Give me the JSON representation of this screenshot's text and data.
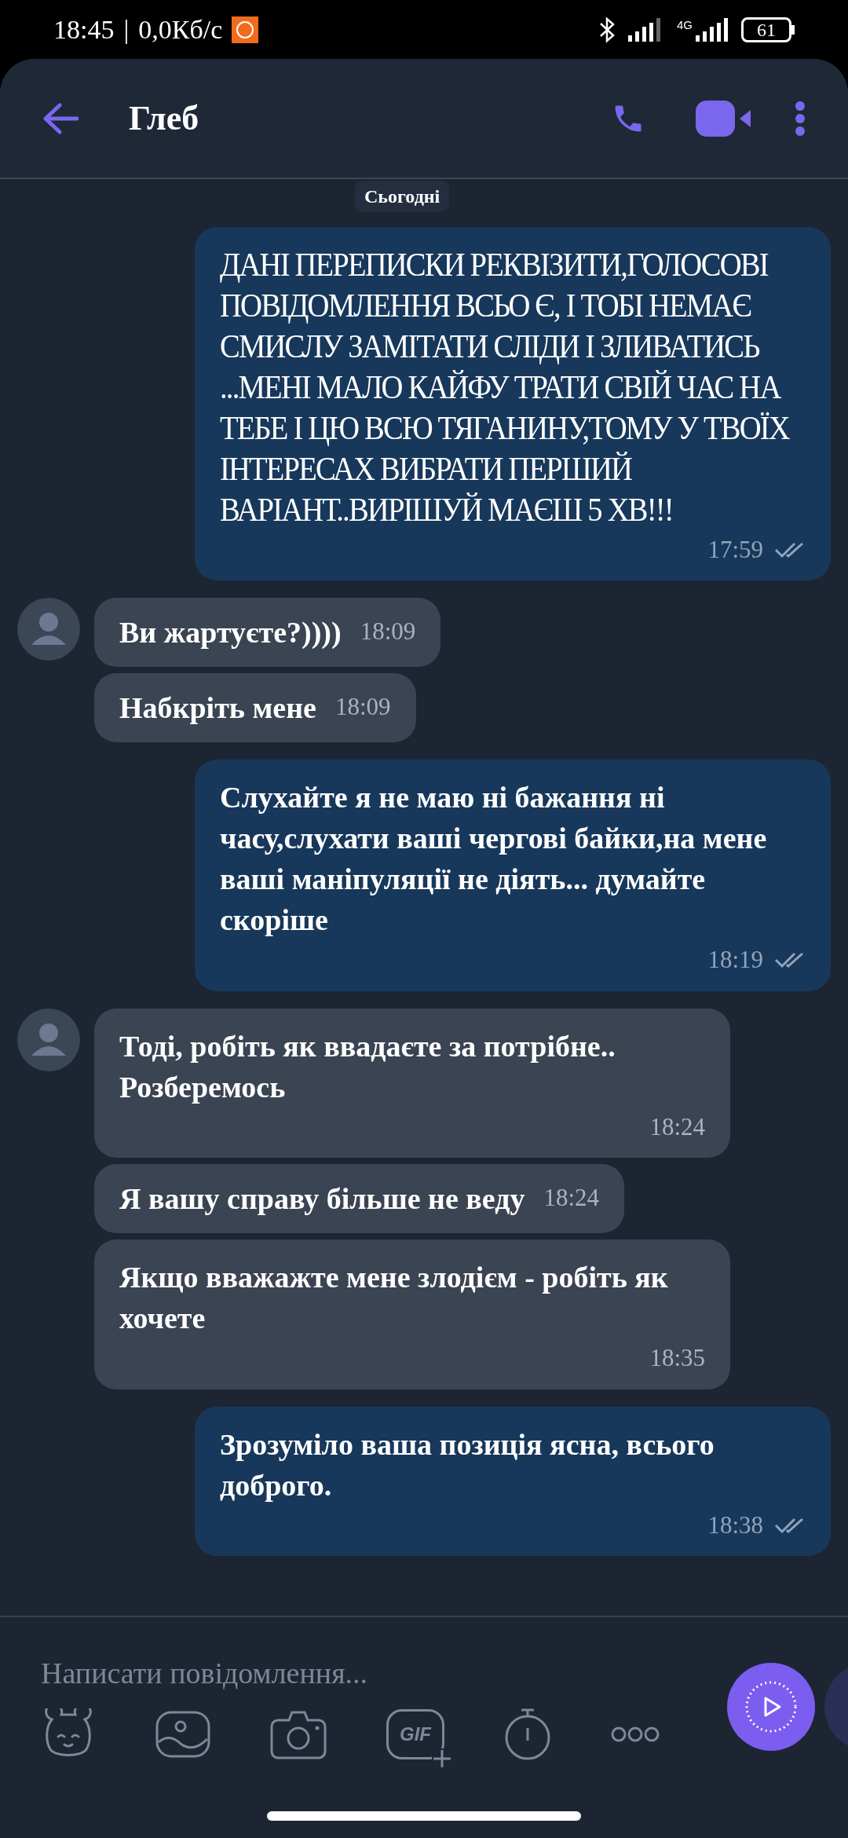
{
  "status_bar": {
    "time": "18:45",
    "separator": "|",
    "speed": "0,0Кб/с",
    "network": "4G",
    "battery": "61"
  },
  "header": {
    "contact": "Глеб"
  },
  "date_badge": "Сьогодні",
  "messages": [
    {
      "kind": "outgoing",
      "text": "ДАНІ ПЕРЕПИСКИ РЕКВІЗИТИ,ГОЛОСОВІ ПОВІДОМЛЕННЯ ВСЬО Є, І ТОБІ НЕМАЄ СМИСЛУ ЗАМІТАТИ СЛІДИ І ЗЛИВАТИСЬ ...МЕНІ МАЛО КАЙФУ ТРАТИ СВІЙ ЧАС НА ТЕБЕ І ЦЮ ВСЮ ТЯГАНИНУ,ТОМУ У ТВОЇХ ІНТЕРЕСАХ ВИБРАТИ ПЕРШИЙ ВАРІАНТ..ВИРІШУЙ МАЄШ 5 ХВ!!!",
      "time": "17:59",
      "read": true
    },
    {
      "kind": "incoming",
      "avatar": true,
      "text": "Ви жартуєте?))))",
      "time": "18:09"
    },
    {
      "kind": "incoming",
      "avatar": false,
      "text": "Набкріть мене",
      "time": "18:09"
    },
    {
      "kind": "outgoing",
      "text": "Слухайте я не маю ні бажання ні часу,слухати ваші чергові байки,на мене ваші маніпуляції не діять... думайте скоріше",
      "time": "18:19",
      "read": true
    },
    {
      "kind": "incoming",
      "avatar": true,
      "text": "Тоді, робіть як ввадаєте за потрібне.. Розберемось",
      "time": "18:24"
    },
    {
      "kind": "incoming",
      "avatar": false,
      "text": "Я вашу справу більше не веду",
      "time": "18:24"
    },
    {
      "kind": "incoming",
      "avatar": false,
      "text": "Якщо вважажте мене злодієм - робіть як хочете",
      "time": "18:35"
    },
    {
      "kind": "outgoing",
      "text": "Зрозуміло ваша позиція ясна, всього доброго.",
      "time": "18:38",
      "read": true
    }
  ],
  "composer": {
    "placeholder": "Написати повідомлення...",
    "gif_label": "GIF"
  }
}
